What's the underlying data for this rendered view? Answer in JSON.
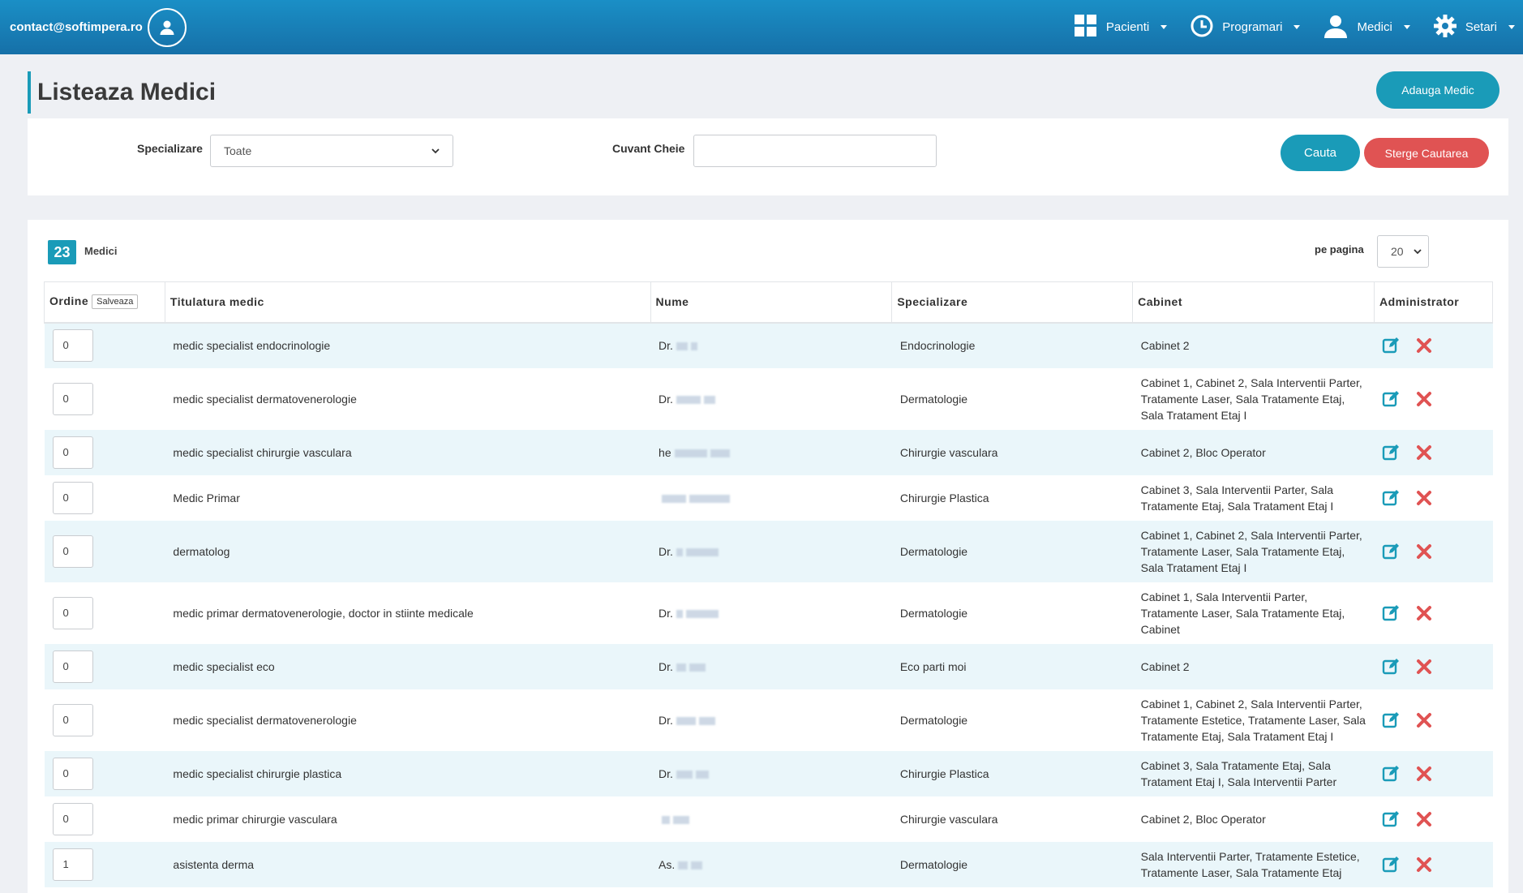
{
  "header": {
    "email": "contact@softimpera.ro",
    "nav": [
      {
        "label": "Pacienti",
        "icon": "grid-icon"
      },
      {
        "label": "Programari",
        "icon": "clock-icon"
      },
      {
        "label": "Medici",
        "icon": "user-icon"
      },
      {
        "label": "Setari",
        "icon": "gear-icon"
      }
    ]
  },
  "page": {
    "title": "Listeaza Medici",
    "add_button": "Adauga Medic"
  },
  "filters": {
    "specializare_label": "Specializare",
    "specializare_value": "Toate",
    "keyword_label": "Cuvant Cheie",
    "keyword_value": "",
    "search_button": "Cauta",
    "clear_button": "Sterge Cautarea"
  },
  "list": {
    "count": "23",
    "count_label": "Medici",
    "per_page_label": "pe pagina",
    "per_page_value": "20",
    "columns": {
      "ordine": "Ordine",
      "save": "Salveaza",
      "titulatura": "Titulatura medic",
      "nume": "Nume",
      "specializare": "Specializare",
      "cabinet": "Cabinet",
      "administrator": "Administrator"
    },
    "rows": [
      {
        "order": "0",
        "title": "medic specialist endocrinologie",
        "name": "Dr.",
        "spec": "Endocrinologie",
        "cabinet": "Cabinet 2"
      },
      {
        "order": "0",
        "title": "medic specialist dermatovenerologie",
        "name": "Dr.",
        "spec": "Dermatologie",
        "cabinet": "Cabinet 1, Cabinet 2, Sala Interventii Parter, Tratamente Laser, Sala Tratamente Etaj, Sala Tratament Etaj I"
      },
      {
        "order": "0",
        "title": "medic specialist chirurgie vasculara",
        "name": "he",
        "spec": "Chirurgie vasculara",
        "cabinet": "Cabinet 2, Bloc Operator"
      },
      {
        "order": "0",
        "title": "Medic Primar",
        "name": "",
        "spec": "Chirurgie Plastica",
        "cabinet": "Cabinet 3, Sala Interventii Parter, Sala Tratamente Etaj, Sala Tratament Etaj I"
      },
      {
        "order": "0",
        "title": "dermatolog",
        "name": "Dr.",
        "spec": "Dermatologie",
        "cabinet": "Cabinet 1, Cabinet 2, Sala Interventii Parter, Tratamente Laser, Sala Tratamente Etaj, Sala Tratament Etaj I"
      },
      {
        "order": "0",
        "title": "medic primar dermatovenerologie, doctor in stiinte medicale",
        "name": "Dr.",
        "spec": "Dermatologie",
        "cabinet": "Cabinet 1, Sala Interventii Parter, Tratamente Laser, Sala Tratamente Etaj, Cabinet"
      },
      {
        "order": "0",
        "title": "medic specialist eco",
        "name": "Dr.",
        "spec": "Eco parti moi",
        "cabinet": "Cabinet 2"
      },
      {
        "order": "0",
        "title": "medic specialist dermatovenerologie",
        "name": "Dr.",
        "spec": "Dermatologie",
        "cabinet": "Cabinet 1, Cabinet 2, Sala Interventii Parter, Tratamente Estetice, Tratamente Laser, Sala Tratamente Etaj, Sala Tratament Etaj I"
      },
      {
        "order": "0",
        "title": "medic specialist chirurgie plastica",
        "name": "Dr.",
        "spec": "Chirurgie Plastica",
        "cabinet": "Cabinet 3, Sala Tratamente Etaj, Sala Tratament Etaj I, Sala Interventii Parter"
      },
      {
        "order": "0",
        "title": "medic primar chirurgie vasculara",
        "name": "",
        "spec": "Chirurgie vasculara",
        "cabinet": "Cabinet 2, Bloc Operator"
      },
      {
        "order": "1",
        "title": "asistenta derma",
        "name": "As.",
        "spec": "Dermatologie",
        "cabinet": "Sala Interventii Parter, Tratamente Estetice, Tratamente Laser, Sala Tratamente Etaj"
      }
    ]
  },
  "colors": {
    "header": "#1a7fb8",
    "accent": "#1a9bb8",
    "danger": "#e05353",
    "row_alt": "#eaf6fa"
  }
}
